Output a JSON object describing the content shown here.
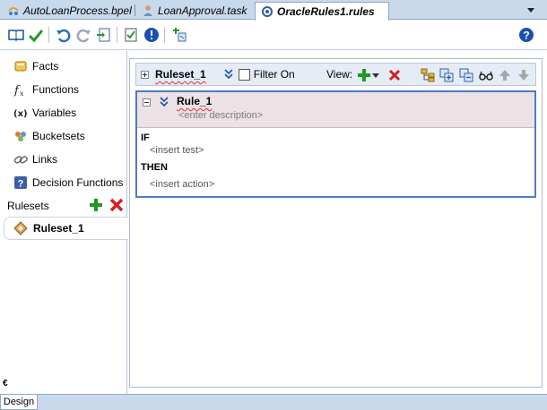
{
  "tabs": [
    {
      "label": "AutoLoanProcess.bpel",
      "icon": "bpel-process-icon",
      "active": false
    },
    {
      "label": "LoanApproval.task",
      "icon": "human-task-icon",
      "active": false
    },
    {
      "label": "OracleRules1.rules",
      "icon": "rules-file-icon",
      "active": true
    }
  ],
  "toolbar": {
    "icons": [
      "book-icon",
      "check-icon",
      "undo-icon",
      "redo-icon",
      "export-icon",
      "validate-icon",
      "info-icon",
      "test-icon",
      "help-icon"
    ]
  },
  "sidebar": {
    "items": [
      {
        "label": "Facts",
        "icon": "facts-icon"
      },
      {
        "label": "Functions",
        "icon": "functions-icon"
      },
      {
        "label": "Variables",
        "icon": "variables-icon"
      },
      {
        "label": "Bucketsets",
        "icon": "bucketsets-icon"
      },
      {
        "label": "Links",
        "icon": "links-icon"
      },
      {
        "label": "Decision Functions",
        "icon": "decision-functions-icon"
      }
    ],
    "rulesets_label": "Rulesets",
    "ruleset_item": "Ruleset_1"
  },
  "ruleset_header": {
    "name": "Ruleset_1",
    "filter_label": "Filter On",
    "filter_checked": false,
    "view_label": "View:"
  },
  "rule": {
    "name": "Rule_1",
    "description_placeholder": "<enter description>",
    "if_label": "IF",
    "test_placeholder": "<insert test>",
    "then_label": "THEN",
    "action_placeholder": "<insert action>"
  },
  "bottom": {
    "collapse_glyph": "€",
    "design_tab": "Design"
  },
  "colors": {
    "tab_bar": "#c9d9ec",
    "rule_header": "#ece1e4",
    "rule_border": "#4c7cc8",
    "add_green": "#1f9a1f",
    "delete_red": "#d22020"
  }
}
